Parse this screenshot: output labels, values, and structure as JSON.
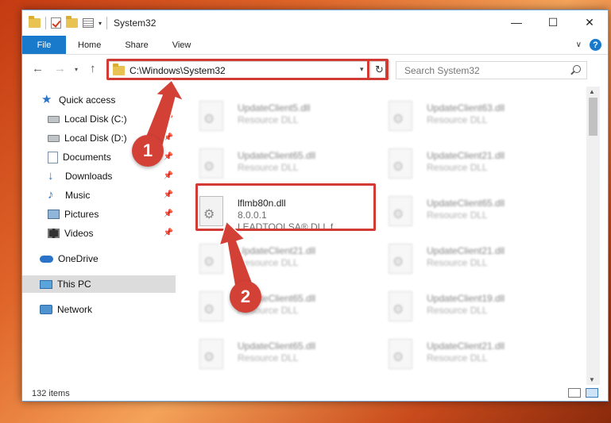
{
  "window": {
    "title": "System32",
    "controls": {
      "minimize": "—",
      "maximize": "☐",
      "close": "✕"
    }
  },
  "ribbon": {
    "tabs": [
      "File",
      "Home",
      "Share",
      "View"
    ],
    "help": "?"
  },
  "nav": {
    "address": "C:\\Windows\\System32",
    "search_placeholder": "Search System32"
  },
  "sidebar": {
    "items": [
      {
        "label": "Quick access",
        "icon": "quick-access-star-icon"
      },
      {
        "label": "Local Disk (C:)",
        "icon": "drive-icon",
        "pinned": true
      },
      {
        "label": "Local Disk (D:)",
        "icon": "drive-icon",
        "pinned": true
      },
      {
        "label": "Documents",
        "icon": "documents-icon",
        "pinned": true
      },
      {
        "label": "Downloads",
        "icon": "downloads-icon",
        "pinned": true
      },
      {
        "label": "Music",
        "icon": "music-icon",
        "pinned": true
      },
      {
        "label": "Pictures",
        "icon": "pictures-icon",
        "pinned": true
      },
      {
        "label": "Videos",
        "icon": "videos-icon",
        "pinned": true
      },
      {
        "label": "OneDrive",
        "icon": "onedrive-icon"
      },
      {
        "label": "This PC",
        "icon": "this-pc-icon",
        "selected": true
      },
      {
        "label": "Network",
        "icon": "network-icon"
      }
    ]
  },
  "files": {
    "left": [
      {
        "name": "UpdateClient5.dll",
        "type": "Resource DLL"
      },
      {
        "name": "UpdateClient65.dll",
        "type": "Resource DLL"
      },
      {
        "name": "lflmb80n.dll",
        "version": "8.0.0.1",
        "company": "LEADTOOLSA® DLL f..."
      },
      {
        "name": "UpdateClient21.dll",
        "type": "Resource DLL"
      },
      {
        "name": "UpdateClient65.dll",
        "type": "Resource DLL"
      },
      {
        "name": "UpdateClient65.dll",
        "type": "Resource DLL"
      }
    ],
    "right": [
      {
        "name": "UpdateClient63.dll",
        "type": "Resource DLL"
      },
      {
        "name": "UpdateClient21.dll",
        "type": "Resource DLL"
      },
      {
        "name": "UpdateClient65.dll",
        "type": "Resource DLL"
      },
      {
        "name": "UpdateClient21.dll",
        "type": "Resource DLL"
      },
      {
        "name": "UpdateClient19.dll",
        "type": "Resource DLL"
      },
      {
        "name": "UpdateClient21.dll",
        "type": "Resource DLL"
      }
    ]
  },
  "status": {
    "items": "132 items"
  },
  "annotations": {
    "step1": "1",
    "step2": "2",
    "color": "#d23b33"
  }
}
